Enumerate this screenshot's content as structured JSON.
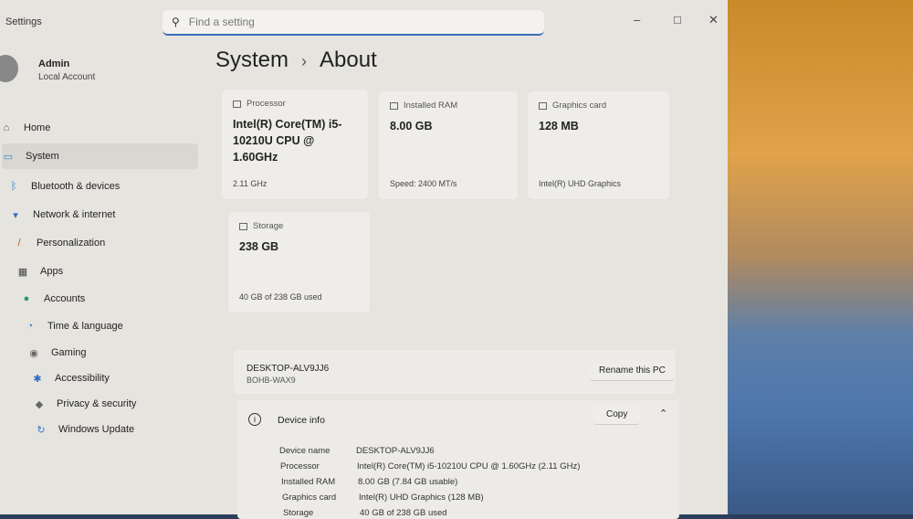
{
  "window": {
    "title": "Settings",
    "search_placeholder": "Find a setting"
  },
  "user": {
    "name": "Admin",
    "type": "Local Account"
  },
  "nav": [
    {
      "label": "Home",
      "icon": "home-icon"
    },
    {
      "label": "System",
      "icon": "system-icon",
      "selected": true
    },
    {
      "label": "Bluetooth & devices",
      "icon": "bluetooth-icon"
    },
    {
      "label": "Network & internet",
      "icon": "wifi-icon"
    },
    {
      "label": "Personalization",
      "icon": "brush-icon"
    },
    {
      "label": "Apps",
      "icon": "apps-icon"
    },
    {
      "label": "Accounts",
      "icon": "accounts-icon"
    },
    {
      "label": "Time & language",
      "icon": "globe-icon"
    },
    {
      "label": "Gaming",
      "icon": "gamepad-icon"
    },
    {
      "label": "Accessibility",
      "icon": "accessibility-icon"
    },
    {
      "label": "Privacy & security",
      "icon": "shield-icon"
    },
    {
      "label": "Windows Update",
      "icon": "update-icon"
    }
  ],
  "breadcrumb": {
    "parent": "System",
    "sep": "›",
    "current": "About"
  },
  "cards": [
    {
      "label": "Processor",
      "value": "Intel(R) Core(TM) i5-10210U CPU @ 1.60GHz",
      "sub": "2.11 GHz"
    },
    {
      "label": "Installed RAM",
      "value": "8.00 GB",
      "sub": "Speed: 2400 MT/s"
    },
    {
      "label": "Graphics card",
      "value": "128 MB",
      "sub": "Intel(R) UHD Graphics"
    },
    {
      "label": "Storage",
      "value": "238 GB",
      "sub": "40 GB of 238 GB used"
    }
  ],
  "pc": {
    "name": "DESKTOP-ALV9JJ6",
    "model": "BOHB-WAX9",
    "rename_label": "Rename this PC"
  },
  "device_info": {
    "title": "Device info",
    "copy_label": "Copy",
    "rows": [
      {
        "k": "Device name",
        "v": "DESKTOP-ALV9JJ6"
      },
      {
        "k": "Processor",
        "v": "Intel(R) Core(TM) i5-10210U CPU @ 1.60GHz (2.11 GHz)"
      },
      {
        "k": "Installed RAM",
        "v": "8.00 GB (7.84 GB usable)"
      },
      {
        "k": "Graphics card",
        "v": "Intel(R) UHD Graphics (128 MB)"
      },
      {
        "k": "Storage",
        "v": "40 GB of 238 GB used"
      }
    ]
  }
}
